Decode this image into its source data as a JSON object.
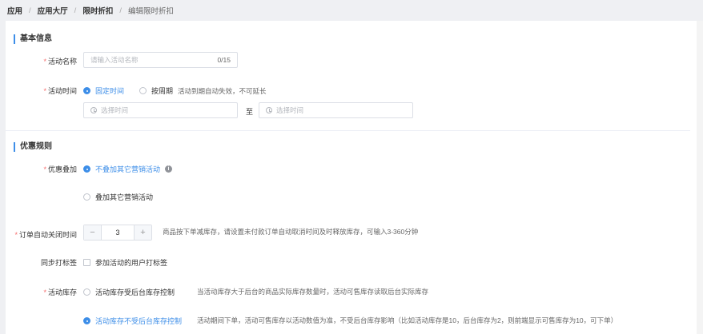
{
  "breadcrumb": {
    "items": [
      "应用",
      "应用大厅",
      "限时折扣"
    ],
    "current": "编辑限时折扣",
    "separator": "/"
  },
  "section_basic": {
    "title": "基本信息"
  },
  "activity_name": {
    "label": "活动名称",
    "placeholder": "请输入活动名称",
    "count": "0/15"
  },
  "activity_time": {
    "label": "活动时间",
    "option_fixed": "固定时间",
    "option_cycle": "按周期",
    "hint": "活动到期自动失效，不可延长",
    "start_placeholder": "选择时间",
    "end_placeholder": "选择时间",
    "range_sep": "至"
  },
  "section_rules": {
    "title": "优惠规则"
  },
  "stacking": {
    "label": "优惠叠加",
    "option_no": "不叠加其它营销活动",
    "option_yes": "叠加其它营销活动",
    "info_icon": "i"
  },
  "order_close": {
    "label": "订单自动关闭时间",
    "minus": "−",
    "value": "3",
    "plus": "+",
    "hint": "商品按下单减库存，请设置未付款订单自动取消时间及时释放库存，可输入3-360分钟"
  },
  "sync_tag": {
    "label": "同步打标签",
    "checkbox_label": "参加活动的用户打标签"
  },
  "inventory": {
    "label": "活动库存",
    "option_limited": "活动库存受后台库存控制",
    "option_limited_hint": "当活动库存大于后台的商品实际库存数量时，活动可售库存读取后台实际库存",
    "option_free": "活动库存不受后台库存控制",
    "option_free_hint": "活动期间下单，活动可售库存以活动数值为准，不受后台库存影响（比如活动库存是10，后台库存为2，则前端显示可售库存为10，可下单）"
  },
  "required_mark": "*",
  "colors": {
    "accent": "#3d8ee8",
    "required": "#f56c6c"
  }
}
